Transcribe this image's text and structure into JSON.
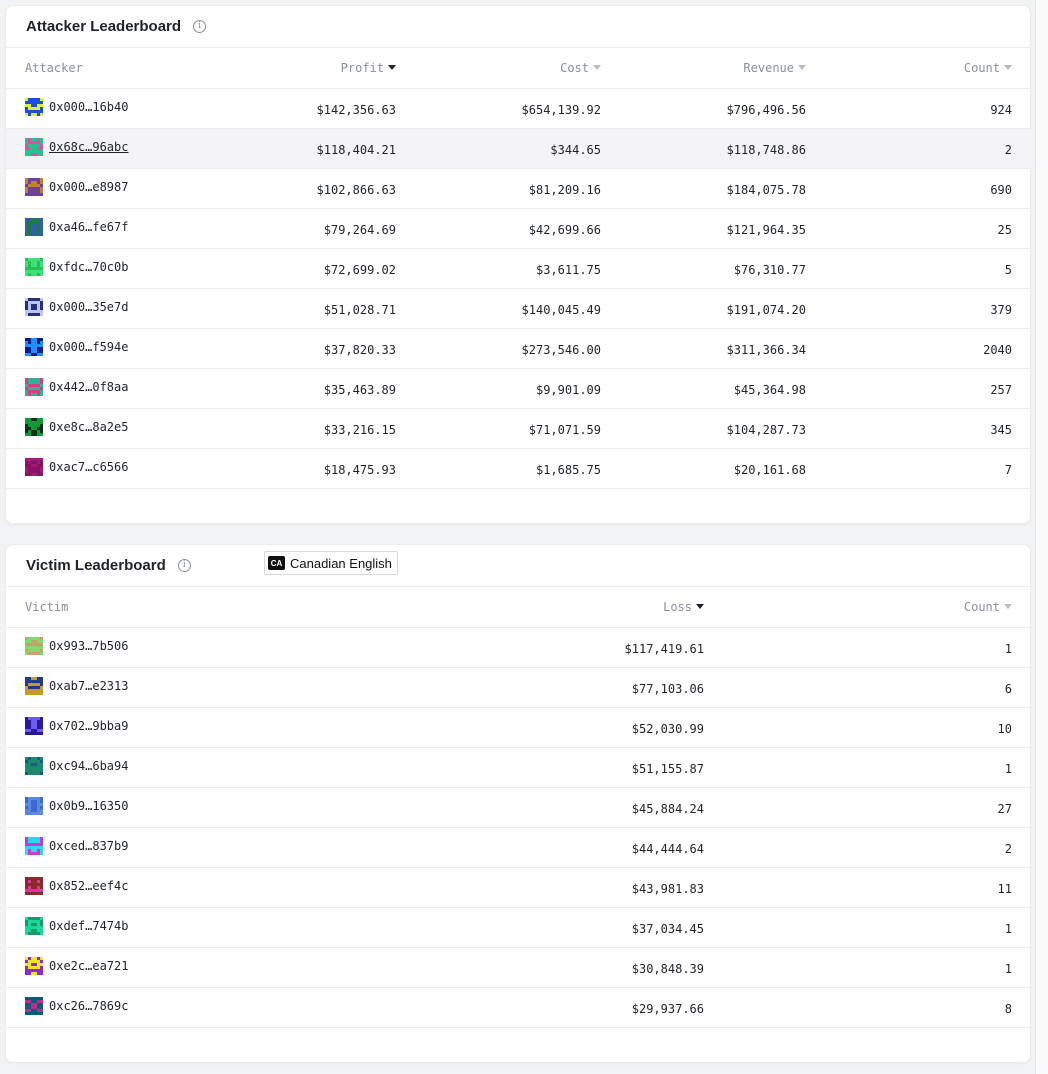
{
  "attacker": {
    "title": "Attacker Leaderboard",
    "info_icon": "i",
    "columns": {
      "attacker": "Attacker",
      "profit": "Profit",
      "cost": "Cost",
      "revenue": "Revenue",
      "count": "Count"
    },
    "rows": [
      {
        "address": "0x000…16b40",
        "profit": "$142,356.63",
        "cost": "$654,139.92",
        "revenue": "$796,496.56",
        "count": "924"
      },
      {
        "address": "0x68c…96abc",
        "profit": "$118,404.21",
        "cost": "$344.65",
        "revenue": "$118,748.86",
        "count": "2"
      },
      {
        "address": "0x000…e8987",
        "profit": "$102,866.63",
        "cost": "$81,209.16",
        "revenue": "$184,075.78",
        "count": "690"
      },
      {
        "address": "0xa46…fe67f",
        "profit": "$79,264.69",
        "cost": "$42,699.66",
        "revenue": "$121,964.35",
        "count": "25"
      },
      {
        "address": "0xfdc…70c0b",
        "profit": "$72,699.02",
        "cost": "$3,611.75",
        "revenue": "$76,310.77",
        "count": "5"
      },
      {
        "address": "0x000…35e7d",
        "profit": "$51,028.71",
        "cost": "$140,045.49",
        "revenue": "$191,074.20",
        "count": "379"
      },
      {
        "address": "0x000…f594e",
        "profit": "$37,820.33",
        "cost": "$273,546.00",
        "revenue": "$311,366.34",
        "count": "2040"
      },
      {
        "address": "0x442…0f8aa",
        "profit": "$35,463.89",
        "cost": "$9,901.09",
        "revenue": "$45,364.98",
        "count": "257"
      },
      {
        "address": "0xe8c…8a2e5",
        "profit": "$33,216.15",
        "cost": "$71,071.59",
        "revenue": "$104,287.73",
        "count": "345"
      },
      {
        "address": "0xac7…c6566",
        "profit": "$18,475.93",
        "cost": "$1,685.75",
        "revenue": "$20,161.68",
        "count": "7"
      }
    ]
  },
  "victim": {
    "title": "Victim Leaderboard",
    "info_icon": "i",
    "columns": {
      "victim": "Victim",
      "loss": "Loss",
      "count": "Count"
    },
    "rows": [
      {
        "address": "0x993…7b506",
        "loss": "$117,419.61",
        "count": "1"
      },
      {
        "address": "0xab7…e2313",
        "loss": "$77,103.06",
        "count": "6"
      },
      {
        "address": "0x702…9bba9",
        "loss": "$52,030.99",
        "count": "10"
      },
      {
        "address": "0xc94…6ba94",
        "loss": "$51,155.87",
        "count": "1"
      },
      {
        "address": "0x0b9…16350",
        "loss": "$45,884.24",
        "count": "27"
      },
      {
        "address": "0xced…837b9",
        "loss": "$44,444.64",
        "count": "2"
      },
      {
        "address": "0x852…eef4c",
        "loss": "$43,981.83",
        "count": "11"
      },
      {
        "address": "0xdef…7474b",
        "loss": "$37,034.45",
        "count": "1"
      },
      {
        "address": "0xe2c…ea721",
        "loss": "$30,848.39",
        "count": "1"
      },
      {
        "address": "0xc26…7869c",
        "loss": "$29,937.66",
        "count": "8"
      }
    ]
  },
  "language_badge": {
    "code": "CA",
    "label": "Canadian English"
  },
  "colors": {
    "attacker_avatars": [
      [
        "#1d4ed8",
        "#d9f23a"
      ],
      [
        "#22c48b",
        "#e04fa0"
      ],
      [
        "#c0832a",
        "#6d3f9e"
      ],
      [
        "#2f5fa8",
        "#1c7a3c"
      ],
      [
        "#3be37a",
        "#2bbf5a"
      ],
      [
        "#2a2f7a",
        "#b8c6f0"
      ],
      [
        "#1f8fff",
        "#0a1c8a"
      ],
      [
        "#d83f7a",
        "#2ab39a"
      ],
      [
        "#0f9a38",
        "#08301a"
      ],
      [
        "#a0187a",
        "#8a1060"
      ]
    ],
    "victim_avatars": [
      [
        "#7ddc6a",
        "#d49a6a"
      ],
      [
        "#1f3a8a",
        "#c69a2a"
      ],
      [
        "#2a1a9a",
        "#6a5cf0"
      ],
      [
        "#1a8a6a",
        "#1a5a8a"
      ],
      [
        "#5a8ae0",
        "#3a6acf"
      ],
      [
        "#2ad8e8",
        "#c63ad8"
      ],
      [
        "#d83a9a",
        "#8a2a2a"
      ],
      [
        "#1ad89a",
        "#1a9a6a"
      ],
      [
        "#e8e81a",
        "#8a2ad8"
      ],
      [
        "#0a5a7a",
        "#c62a8a"
      ]
    ]
  }
}
